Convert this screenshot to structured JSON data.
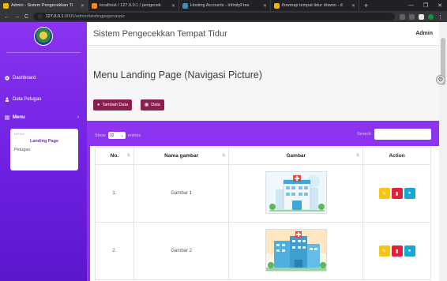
{
  "browser": {
    "tabs": [
      {
        "label": "Admin - Sistem Pengecekkan Ti",
        "active": true,
        "color": "#f4b400"
      },
      {
        "label": "localhost / 127.0.0.1 / pengecek",
        "active": false,
        "color": "#f08a24"
      },
      {
        "label": "Hosting Accounts - InfinityFree",
        "active": false,
        "color": "#3c8dbc"
      },
      {
        "label": "flowmap tempat tidur drawio - d",
        "active": false,
        "color": "#f4b400"
      }
    ],
    "new_tab": "+",
    "address_host": "127.0.0.1",
    "address_path": ":8000/admin/landingpagenavpic"
  },
  "sidebar": {
    "items": [
      {
        "label": "Dashboard",
        "icon": "dashboard-icon"
      },
      {
        "label": "Data Petugas",
        "icon": "user-icon"
      },
      {
        "label": "Menu",
        "icon": "menu-icon"
      }
    ],
    "submenu": {
      "header": "MENU :",
      "items": [
        {
          "label": "Landing Page",
          "active": true
        },
        {
          "label": "Petugas",
          "active": false
        }
      ]
    }
  },
  "topbar": {
    "title": "Sistem Pengecekkan Tempat Tidur",
    "user": "Admin"
  },
  "main": {
    "page_title": "Menu Landing Page (Navigasi Picture)",
    "buttons": {
      "add": "Tambah Data",
      "data": "Data"
    },
    "table_controls": {
      "show": "Show",
      "entries_value": "10",
      "entries": "entries",
      "search": "Search:"
    },
    "columns": [
      "No.",
      "Nama gambar",
      "Gambar",
      "Action"
    ],
    "rows": [
      {
        "no": "1.",
        "name": "Gambar 1",
        "image": "hospital-illustration-1"
      },
      {
        "no": "2.",
        "name": "Gambar 2",
        "image": "hospital-illustration-2"
      }
    ]
  },
  "colors": {
    "sidebar": "#7a28e8",
    "button": "#8a1f4f",
    "edit": "#f5c518",
    "delete": "#e0213a",
    "view": "#18a6d6"
  }
}
